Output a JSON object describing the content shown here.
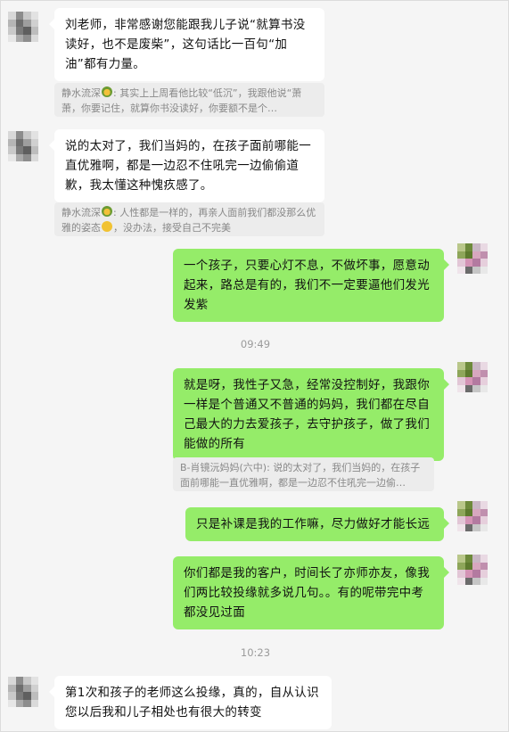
{
  "messages": [
    {
      "text": "刘老师，非常感谢您能跟我儿子说“就算书没读好，也不是废柴”，这句话比一百句“加油”都有力量。"
    },
    {
      "quote_name": "静水流深",
      "quote_text": "其实上上周看他比较“低沉”，我跟他说“萧萧，你要记住，就算你书没读好，你要额不是个…"
    },
    {
      "text": "说的太对了，我们当妈的，在孩子面前哪能一直优雅啊，都是一边忍不住吼完一边偷偷道歉，我太懂这种愧疚感了。"
    },
    {
      "quote_name": "静水流深",
      "quote_text_a": "人性都是一样的，再亲人面前我们都没那么优雅的姿态",
      "quote_text_b": "，没办法，接受自己不完美"
    },
    {
      "text": "一个孩子，只要心灯不息，不做坏事，愿意动起来，路总是有的，我们不一定要逼他们发光发紫"
    },
    {
      "time": "09:49"
    },
    {
      "text": "就是呀，我性子又急，经常没控制好，我跟你一样是个普通又不普通的妈妈，我们都在尽自己最大的力去爱孩子，去守护孩子，做了我们能做的所有"
    },
    {
      "quote_name": "B-肖镜沅妈妈(六中)",
      "quote_text": "说的太对了，我们当妈的，在孩子面前哪能一直优雅啊，都是一边忍不住吼完一边偷…"
    },
    {
      "text": "只是补课是我的工作嘛，尽力做好才能长远"
    },
    {
      "text": "你们都是我的客户，时间长了亦师亦友，像我们两比较投缘就多说几句。。有的呢带完中考都没见过面"
    },
    {
      "time": "10:23"
    },
    {
      "text": "第1次和孩子的老师这么投缘，真的，自从认识您以后我和儿子相处也有很大的转变"
    }
  ],
  "colors": {
    "background": "#f5f5f5",
    "incoming_bubble": "#ffffff",
    "outgoing_bubble": "#95ec69",
    "quote_background": "#ececec",
    "timestamp": "#9b9b9b"
  }
}
